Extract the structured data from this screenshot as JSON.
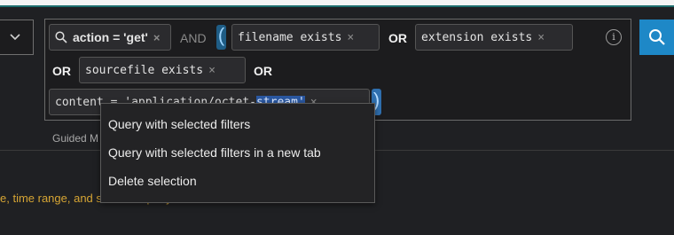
{
  "query": {
    "first_chip": "action = 'get'",
    "op_and": "AND",
    "paren_open": "(",
    "paren_close": ")",
    "chip_filename": "filename exists",
    "op_or_1": "OR",
    "chip_extension": "extension exists",
    "op_or_2": "OR",
    "chip_sourcefile": "sourcefile exists",
    "op_or_3": "OR",
    "selected_chip": {
      "before": "content = 'application/octet-",
      "highlighted": "stream'"
    },
    "remove_symbol": "×"
  },
  "guided_label": "Guided M",
  "hint_text": "e, time range, and submit a query",
  "context_menu": {
    "items": [
      "Query with selected filters",
      "Query with selected filters in a new tab",
      "Delete selection"
    ]
  },
  "colors": {
    "accent": "#1e88c7",
    "hint": "#d6a534",
    "selection": "#2a57a0"
  },
  "icons": {
    "dropdown": "chevron-down-icon",
    "search": "search-icon",
    "info": "info-icon",
    "filter_search": "magnifier-icon"
  }
}
